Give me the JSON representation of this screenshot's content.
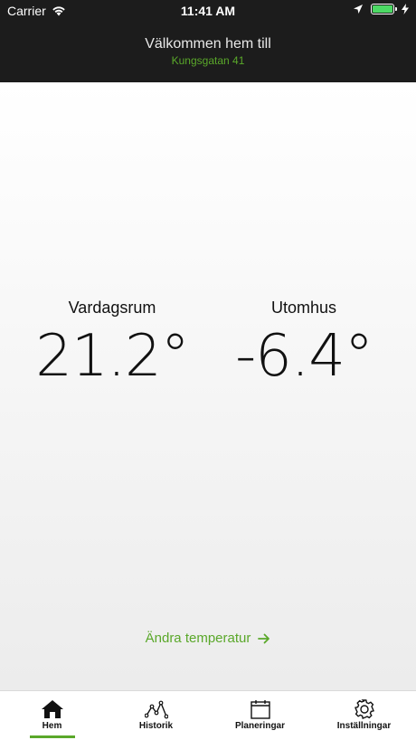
{
  "status_bar": {
    "carrier": "Carrier",
    "time": "11:41 AM"
  },
  "header": {
    "welcome": "Välkommen hem till",
    "address": "Kungsgatan 41"
  },
  "main": {
    "indoor": {
      "label": "Vardagsrum",
      "value": "21.2°"
    },
    "outdoor": {
      "label": "Utomhus",
      "value": "-6.4°"
    },
    "change_link": "Ändra temperatur"
  },
  "tabs": [
    {
      "label": "Hem",
      "icon": "home-icon",
      "active": true
    },
    {
      "label": "Historik",
      "icon": "history-graph-icon",
      "active": false
    },
    {
      "label": "Planeringar",
      "icon": "calendar-icon",
      "active": false
    },
    {
      "label": "Inställningar",
      "icon": "gear-icon",
      "active": false
    }
  ],
  "colors": {
    "accent": "#5aa82a",
    "header_bg": "#1c1c1c",
    "battery": "#4cd964"
  }
}
